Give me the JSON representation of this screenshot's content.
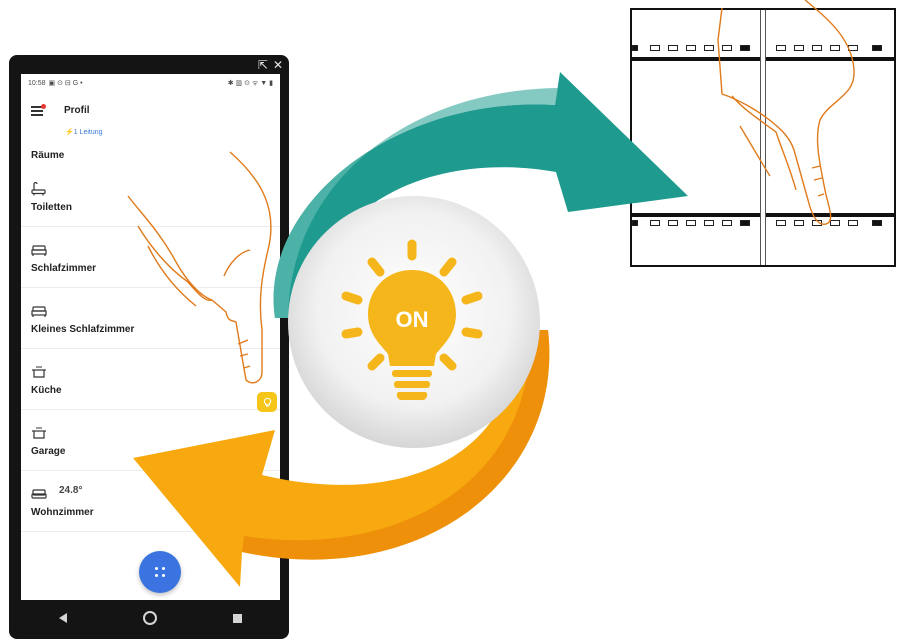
{
  "phone": {
    "window_controls": [
      "⇱",
      "✕"
    ],
    "status": {
      "time": "10:58",
      "left_icons": "▣ ⊙ ⊟ G •",
      "right_icons": "✱ ▥ ⊙ ᯤ ▼ ▮"
    },
    "profile_label": "Profil",
    "connection_label": "⚡1 Leitung",
    "rooms_title": "Räume",
    "rooms": [
      {
        "name": "Toiletten",
        "icon": "bathtub-icon"
      },
      {
        "name": "Schlafzimmer",
        "icon": "bed-icon"
      },
      {
        "name": "Kleines Schlafzimmer",
        "icon": "bed-icon"
      },
      {
        "name": "Küche",
        "icon": "cooking-pot-icon"
      },
      {
        "name": "Garage",
        "icon": "cooking-pot-icon"
      },
      {
        "name": "Wohnzimmer",
        "icon": "sofa-icon",
        "temperature": "24.8°"
      }
    ]
  },
  "bulb": {
    "label": "ON"
  },
  "colors": {
    "teal": "#1f9a8f",
    "orange": "#f5a410",
    "bulb": "#f5b61c",
    "fab": "#3b74e0",
    "finger_outline": "#e07a1a"
  }
}
